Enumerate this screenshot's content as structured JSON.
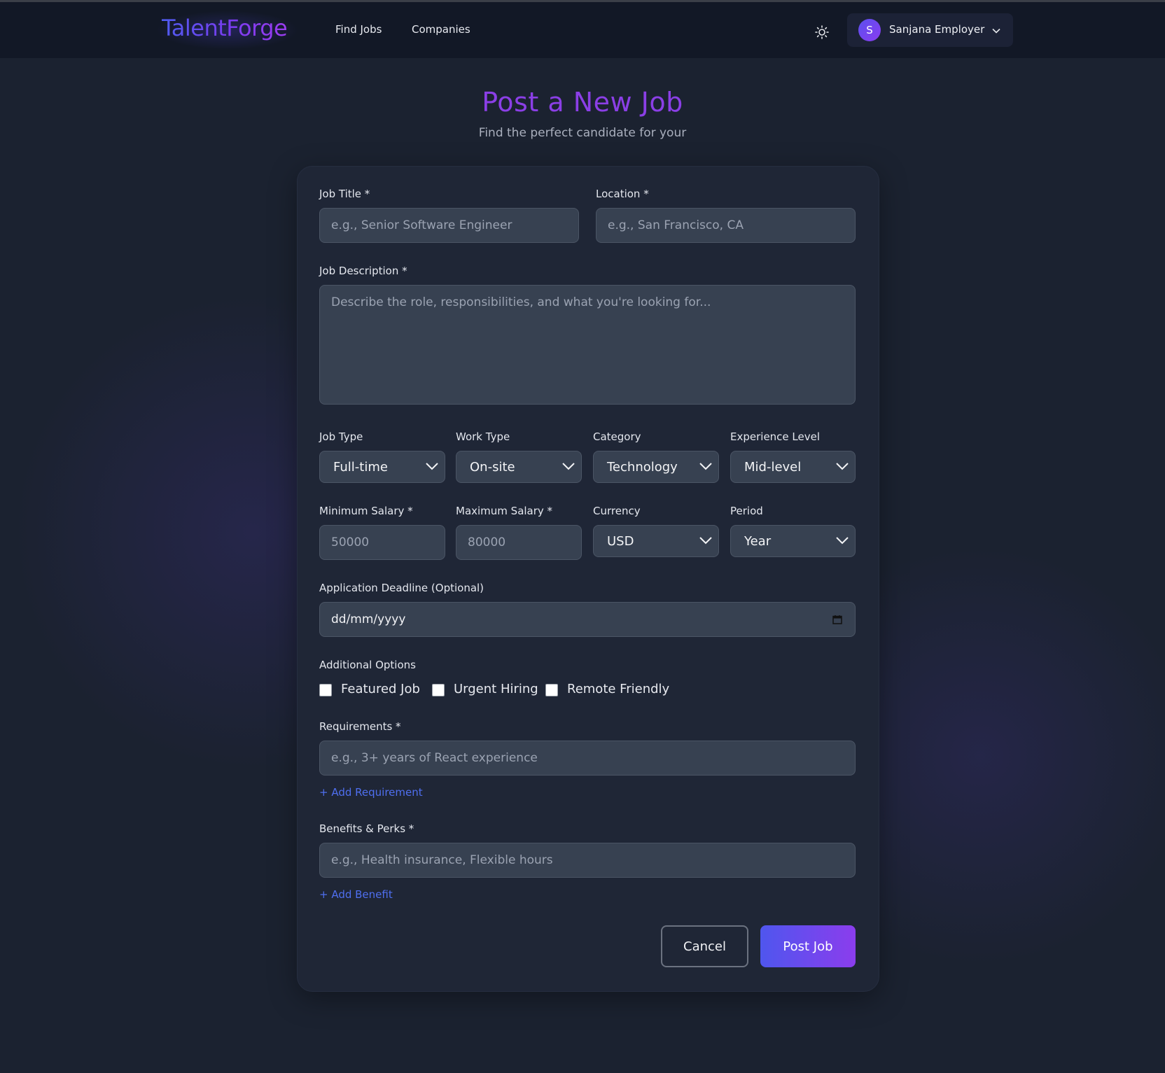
{
  "app": {
    "logo": "TalentForge",
    "nav": {
      "find_jobs": "Find Jobs",
      "companies": "Companies"
    },
    "theme_icon": "sun-icon",
    "user": {
      "initial": "S",
      "name": "Sanjana Employer"
    }
  },
  "page": {
    "title": "Post a New Job",
    "subtitle": "Find the perfect candidate for your"
  },
  "form": {
    "job_title": {
      "label": "Job Title *",
      "placeholder": "e.g., Senior Software Engineer"
    },
    "location": {
      "label": "Location *",
      "placeholder": "e.g., San Francisco, CA"
    },
    "description": {
      "label": "Job Description *",
      "placeholder": "Describe the role, responsibilities, and what you're looking for..."
    },
    "job_type": {
      "label": "Job Type",
      "value": "Full-time"
    },
    "work_type": {
      "label": "Work Type",
      "value": "On-site"
    },
    "category": {
      "label": "Category",
      "value": "Technology"
    },
    "experience": {
      "label": "Experience Level",
      "value": "Mid-level"
    },
    "min_salary": {
      "label": "Minimum Salary *",
      "placeholder": "50000"
    },
    "max_salary": {
      "label": "Maximum Salary *",
      "placeholder": "80000"
    },
    "currency": {
      "label": "Currency",
      "value": "USD"
    },
    "period": {
      "label": "Period",
      "value": "Year"
    },
    "deadline": {
      "label": "Application Deadline (Optional)",
      "value": "dd/mm/yyyy"
    },
    "options": {
      "label": "Additional Options",
      "featured": "Featured Job",
      "urgent": "Urgent Hiring",
      "remote": "Remote Friendly"
    },
    "requirements": {
      "label": "Requirements *",
      "placeholder": "e.g., 3+ years of React experience",
      "add": "+ Add Requirement"
    },
    "benefits": {
      "label": "Benefits & Perks *",
      "placeholder": "e.g., Health insurance, Flexible hours",
      "add": "+ Add Benefit"
    },
    "cancel": "Cancel",
    "submit": "Post Job"
  }
}
